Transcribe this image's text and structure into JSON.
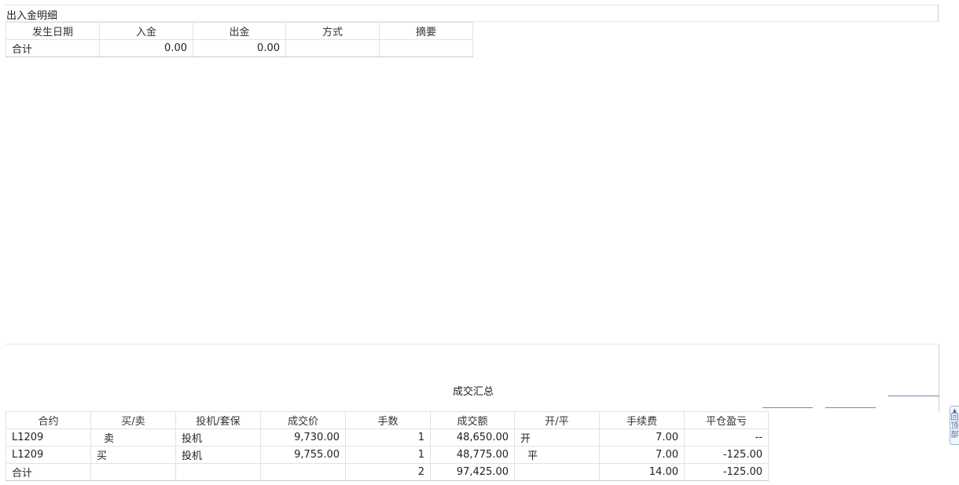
{
  "deposits": {
    "title": "出入金明细",
    "columns": [
      "发生日期",
      "入金",
      "出金",
      "方式",
      "摘要"
    ],
    "total_row": {
      "label": "合计",
      "deposit": "0.00",
      "withdrawal": "0.00",
      "method": "",
      "summary": ""
    }
  },
  "trades": {
    "title": "成交汇总",
    "columns": [
      "合约",
      "买/卖",
      "投机/套保",
      "成交价",
      "手数",
      "成交额",
      "开/平",
      "手续费",
      "平仓盈亏"
    ],
    "rows": [
      {
        "contract": "L1209",
        "side": "卖",
        "hedge": "投机",
        "price": "9,730.00",
        "lots": "1",
        "amount": "48,650.00",
        "open_close": "开",
        "fee": "7.00",
        "pnl": "--"
      },
      {
        "contract": "L1209",
        "side": "买",
        "hedge": "投机",
        "price": "9,755.00",
        "lots": "1",
        "amount": "48,775.00",
        "open_close": "平",
        "fee": "7.00",
        "pnl": "-125.00"
      }
    ],
    "total_row": {
      "label": "合计",
      "lots": "2",
      "amount": "97,425.00",
      "fee": "14.00",
      "pnl": "-125.00"
    }
  },
  "back_to_top": {
    "label": "回顶部"
  }
}
